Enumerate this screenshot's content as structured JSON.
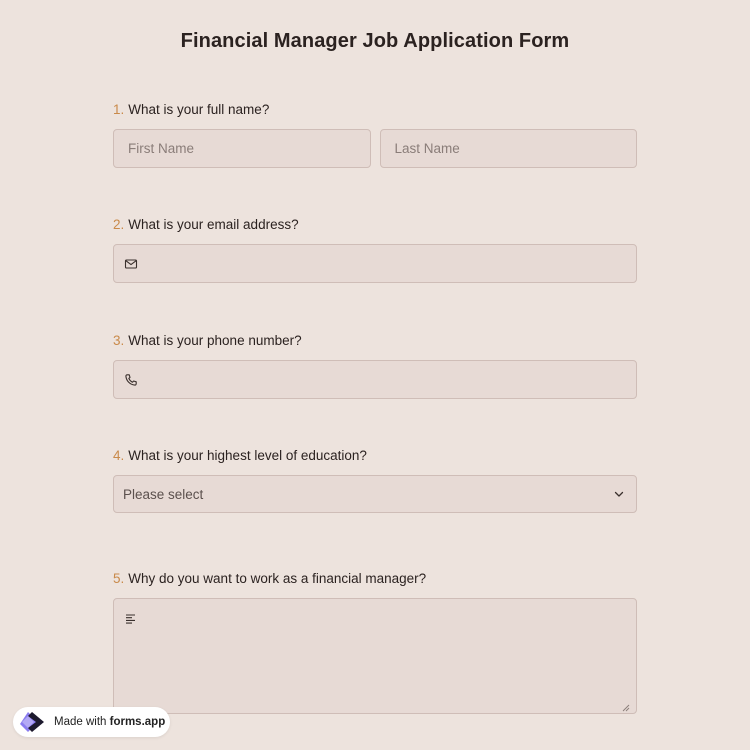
{
  "form": {
    "title": "Financial Manager Job Application Form"
  },
  "questions": [
    {
      "number": "1.",
      "label": "What is your full name?",
      "first_placeholder": "First Name",
      "last_placeholder": "Last Name"
    },
    {
      "number": "2.",
      "label": "What is your email address?",
      "icon": "mail-icon"
    },
    {
      "number": "3.",
      "label": "What is your phone number?",
      "icon": "phone-icon"
    },
    {
      "number": "4.",
      "label": "What is your highest level of education?",
      "selected": "Please select"
    },
    {
      "number": "5.",
      "label": "Why do you want to work as a financial manager?",
      "icon": "text-lines-icon"
    }
  ],
  "badge": {
    "prefix": "Made with",
    "brand": "forms.app"
  },
  "colors": {
    "background": "#ede3dd",
    "field": "#e7dad5",
    "border": "#cfbdb7",
    "number_accent": "#c98a4a",
    "logo": "#6b5ce7"
  }
}
